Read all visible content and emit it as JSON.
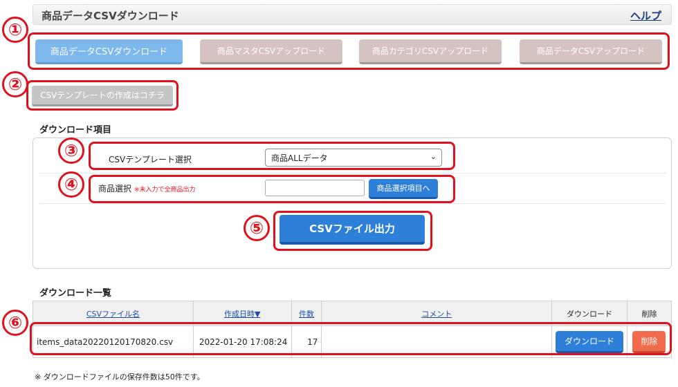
{
  "header": {
    "title": "商品データCSVダウンロード",
    "help": "ヘルプ"
  },
  "tabs": [
    {
      "label": "商品データCSVダウンロード",
      "active": true
    },
    {
      "label": "商品マスタCSVアップロード",
      "active": false
    },
    {
      "label": "商品カテゴリCSVアップロード",
      "active": false
    },
    {
      "label": "商品データCSVアップロード",
      "active": false
    }
  ],
  "template_button": "CSVテンプレートの作成はコチラ",
  "download_section": {
    "title": "ダウンロード項目",
    "template_label": "CSVテンプレート選択",
    "template_selected": "商品ALLデータ",
    "product_label": "商品選択",
    "product_note": "※未入力で全商品出力",
    "product_value": "",
    "product_select_button": "商品選択項目へ",
    "output_button": "CSVファイル出力"
  },
  "download_list": {
    "title": "ダウンロード一覧",
    "columns": [
      "CSVファイル名",
      "作成日時▼",
      "件数",
      "コメント",
      "ダウンロード",
      "削除"
    ],
    "rows": [
      {
        "filename": "items_data20220120170820.csv",
        "created": "2022-01-20 17:08:24",
        "count": "17",
        "comment": "",
        "download_label": "ダウンロード",
        "delete_label": "削除"
      }
    ]
  },
  "footnote": "※ ダウンロードファイルの保存件数は50件です。",
  "markers": [
    "①",
    "②",
    "③",
    "④",
    "⑤",
    "⑥"
  ],
  "colors": {
    "accent_blue": "#2e7fd8",
    "marker_red": "#e0101c",
    "delete_orange": "#f06a4c"
  }
}
